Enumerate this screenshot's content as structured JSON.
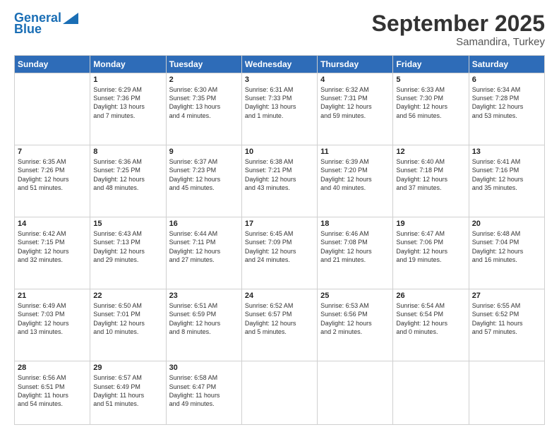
{
  "header": {
    "logo_general": "General",
    "logo_blue": "Blue",
    "month": "September 2025",
    "location": "Samandira, Turkey"
  },
  "weekdays": [
    "Sunday",
    "Monday",
    "Tuesday",
    "Wednesday",
    "Thursday",
    "Friday",
    "Saturday"
  ],
  "weeks": [
    [
      {
        "day": "",
        "info": ""
      },
      {
        "day": "1",
        "info": "Sunrise: 6:29 AM\nSunset: 7:36 PM\nDaylight: 13 hours\nand 7 minutes."
      },
      {
        "day": "2",
        "info": "Sunrise: 6:30 AM\nSunset: 7:35 PM\nDaylight: 13 hours\nand 4 minutes."
      },
      {
        "day": "3",
        "info": "Sunrise: 6:31 AM\nSunset: 7:33 PM\nDaylight: 13 hours\nand 1 minute."
      },
      {
        "day": "4",
        "info": "Sunrise: 6:32 AM\nSunset: 7:31 PM\nDaylight: 12 hours\nand 59 minutes."
      },
      {
        "day": "5",
        "info": "Sunrise: 6:33 AM\nSunset: 7:30 PM\nDaylight: 12 hours\nand 56 minutes."
      },
      {
        "day": "6",
        "info": "Sunrise: 6:34 AM\nSunset: 7:28 PM\nDaylight: 12 hours\nand 53 minutes."
      }
    ],
    [
      {
        "day": "7",
        "info": "Sunrise: 6:35 AM\nSunset: 7:26 PM\nDaylight: 12 hours\nand 51 minutes."
      },
      {
        "day": "8",
        "info": "Sunrise: 6:36 AM\nSunset: 7:25 PM\nDaylight: 12 hours\nand 48 minutes."
      },
      {
        "day": "9",
        "info": "Sunrise: 6:37 AM\nSunset: 7:23 PM\nDaylight: 12 hours\nand 45 minutes."
      },
      {
        "day": "10",
        "info": "Sunrise: 6:38 AM\nSunset: 7:21 PM\nDaylight: 12 hours\nand 43 minutes."
      },
      {
        "day": "11",
        "info": "Sunrise: 6:39 AM\nSunset: 7:20 PM\nDaylight: 12 hours\nand 40 minutes."
      },
      {
        "day": "12",
        "info": "Sunrise: 6:40 AM\nSunset: 7:18 PM\nDaylight: 12 hours\nand 37 minutes."
      },
      {
        "day": "13",
        "info": "Sunrise: 6:41 AM\nSunset: 7:16 PM\nDaylight: 12 hours\nand 35 minutes."
      }
    ],
    [
      {
        "day": "14",
        "info": "Sunrise: 6:42 AM\nSunset: 7:15 PM\nDaylight: 12 hours\nand 32 minutes."
      },
      {
        "day": "15",
        "info": "Sunrise: 6:43 AM\nSunset: 7:13 PM\nDaylight: 12 hours\nand 29 minutes."
      },
      {
        "day": "16",
        "info": "Sunrise: 6:44 AM\nSunset: 7:11 PM\nDaylight: 12 hours\nand 27 minutes."
      },
      {
        "day": "17",
        "info": "Sunrise: 6:45 AM\nSunset: 7:09 PM\nDaylight: 12 hours\nand 24 minutes."
      },
      {
        "day": "18",
        "info": "Sunrise: 6:46 AM\nSunset: 7:08 PM\nDaylight: 12 hours\nand 21 minutes."
      },
      {
        "day": "19",
        "info": "Sunrise: 6:47 AM\nSunset: 7:06 PM\nDaylight: 12 hours\nand 19 minutes."
      },
      {
        "day": "20",
        "info": "Sunrise: 6:48 AM\nSunset: 7:04 PM\nDaylight: 12 hours\nand 16 minutes."
      }
    ],
    [
      {
        "day": "21",
        "info": "Sunrise: 6:49 AM\nSunset: 7:03 PM\nDaylight: 12 hours\nand 13 minutes."
      },
      {
        "day": "22",
        "info": "Sunrise: 6:50 AM\nSunset: 7:01 PM\nDaylight: 12 hours\nand 10 minutes."
      },
      {
        "day": "23",
        "info": "Sunrise: 6:51 AM\nSunset: 6:59 PM\nDaylight: 12 hours\nand 8 minutes."
      },
      {
        "day": "24",
        "info": "Sunrise: 6:52 AM\nSunset: 6:57 PM\nDaylight: 12 hours\nand 5 minutes."
      },
      {
        "day": "25",
        "info": "Sunrise: 6:53 AM\nSunset: 6:56 PM\nDaylight: 12 hours\nand 2 minutes."
      },
      {
        "day": "26",
        "info": "Sunrise: 6:54 AM\nSunset: 6:54 PM\nDaylight: 12 hours\nand 0 minutes."
      },
      {
        "day": "27",
        "info": "Sunrise: 6:55 AM\nSunset: 6:52 PM\nDaylight: 11 hours\nand 57 minutes."
      }
    ],
    [
      {
        "day": "28",
        "info": "Sunrise: 6:56 AM\nSunset: 6:51 PM\nDaylight: 11 hours\nand 54 minutes."
      },
      {
        "day": "29",
        "info": "Sunrise: 6:57 AM\nSunset: 6:49 PM\nDaylight: 11 hours\nand 51 minutes."
      },
      {
        "day": "30",
        "info": "Sunrise: 6:58 AM\nSunset: 6:47 PM\nDaylight: 11 hours\nand 49 minutes."
      },
      {
        "day": "",
        "info": ""
      },
      {
        "day": "",
        "info": ""
      },
      {
        "day": "",
        "info": ""
      },
      {
        "day": "",
        "info": ""
      }
    ]
  ]
}
